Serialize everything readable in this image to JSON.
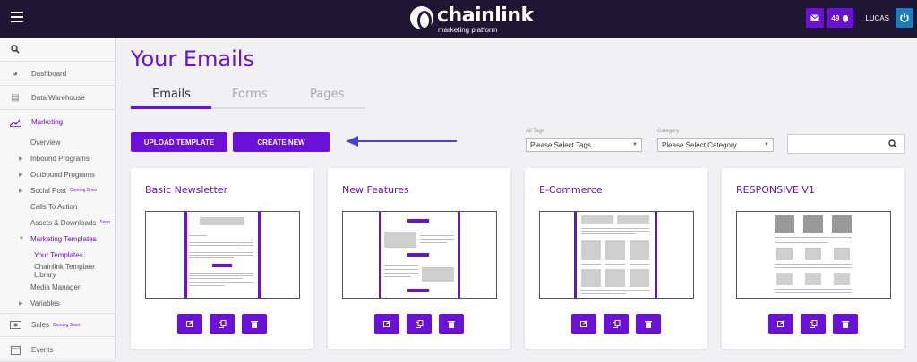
{
  "brand": {
    "name": "chainlink",
    "subtitle": "marketing platform"
  },
  "header": {
    "notif_count": "49",
    "username": "LUCAS"
  },
  "sidebar": {
    "items": [
      {
        "label": "Dashboard"
      },
      {
        "label": "Data Warehouse"
      },
      {
        "label": "Marketing"
      },
      {
        "label": "Overview"
      },
      {
        "label": "Inbound Programs"
      },
      {
        "label": "Outbound Programs"
      },
      {
        "label": "Social Post",
        "badge": "Coming Soon"
      },
      {
        "label": "Calls To Action"
      },
      {
        "label": "Assets & Downloads",
        "badge": "Soon"
      },
      {
        "label": "Marketing Templates"
      },
      {
        "label": "Your Templates"
      },
      {
        "label": "Chainlink Template Library"
      },
      {
        "label": "Media Manager"
      },
      {
        "label": "Variables"
      },
      {
        "label": "Sales",
        "badge": "Coming Soon"
      },
      {
        "label": "Events"
      }
    ]
  },
  "page": {
    "title": "Your Emails"
  },
  "tabs": [
    {
      "label": "Emails"
    },
    {
      "label": "Forms"
    },
    {
      "label": "Pages"
    }
  ],
  "actions": {
    "upload": "UPLOAD TEMPLATE",
    "create": "CREATE NEW"
  },
  "filters": {
    "tags_label": "All Tags",
    "tags_value": "Please Select Tags",
    "category_label": "Category",
    "category_value": "Please Select Category"
  },
  "cards": [
    {
      "title": "Basic Newsletter"
    },
    {
      "title": "New Features"
    },
    {
      "title": "E-Commerce"
    },
    {
      "title": "RESPONSIVE V1"
    }
  ],
  "colors": {
    "accent": "#6a10d8",
    "topbar": "#1e1632",
    "power": "#1a7dbd"
  }
}
